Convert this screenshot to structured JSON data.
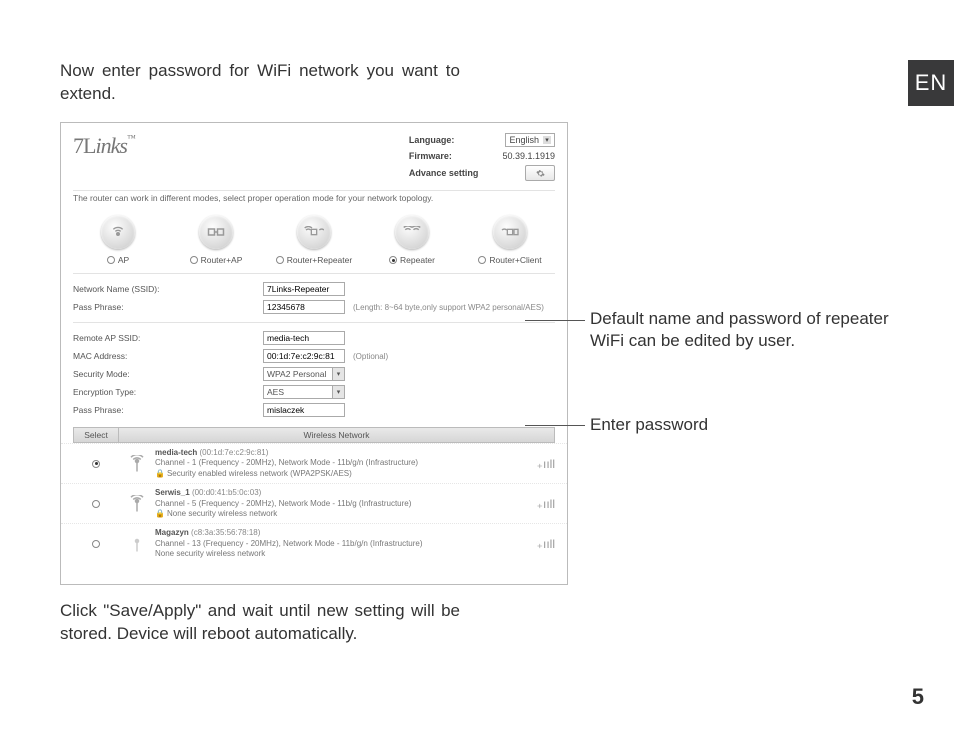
{
  "page": {
    "language_tab": "EN",
    "intro": "Now enter password for WiFi network you want to extend.",
    "outro": "Click \"Save/Apply\" and wait until new setting will be stored. Device will reboot automatically.",
    "page_number": "5"
  },
  "callouts": {
    "c1": "Default name and password of repeater WiFi can be edited by user.",
    "c2": "Enter password"
  },
  "ui": {
    "logo": "7Links",
    "header": {
      "language_label": "Language:",
      "language_value": "English",
      "firmware_label": "Firmware:",
      "firmware_value": "50.39.1.1919",
      "advance_label": "Advance setting"
    },
    "modes_desc": "The router can work in different modes, select proper operation mode for your network topology.",
    "modes": [
      {
        "label": "AP",
        "checked": false
      },
      {
        "label": "Router+AP",
        "checked": false
      },
      {
        "label": "Router+Repeater",
        "checked": false
      },
      {
        "label": "Repeater",
        "checked": true
      },
      {
        "label": "Router+Client",
        "checked": false
      }
    ],
    "section1": {
      "ssid_label": "Network Name (SSID):",
      "ssid_value": "7Links-Repeater",
      "pass_label": "Pass Phrase:",
      "pass_value": "12345678",
      "pass_hint": "(Length: 8~64 byte,only support WPA2 personal/AES)"
    },
    "section2": {
      "remote_ssid_label": "Remote AP SSID:",
      "remote_ssid_value": "media-tech",
      "mac_label": "MAC Address:",
      "mac_value": "00:1d:7e:c2:9c:81",
      "mac_hint": "(Optional)",
      "sec_label": "Security Mode:",
      "sec_value": "WPA2 Personal",
      "enc_label": "Encryption Type:",
      "enc_value": "AES",
      "pass_label": "Pass Phrase:",
      "pass_value": "mislaczek"
    },
    "wireless": {
      "select_header": "Select",
      "list_header": "Wireless Network",
      "rows": [
        {
          "checked": true,
          "secured": true,
          "name": "media-tech",
          "mac": "(00:1d:7e:c2:9c:81)",
          "line1": "Channel - 1 (Frequency - 20MHz), Network Mode - 11b/g/n (Infrastructure)",
          "line2": "Security enabled wireless network (WPA2PSK/AES)"
        },
        {
          "checked": false,
          "secured": true,
          "name": "Serwis_1",
          "mac": "(00:d0:41:b5:0c:03)",
          "line1": "Channel - 5 (Frequency - 20MHz), Network Mode - 11b/g (Infrastructure)",
          "line2": "None security wireless network"
        },
        {
          "checked": false,
          "secured": false,
          "name": "Magazyn",
          "mac": "(c8:3a:35:56:78:18)",
          "line1": "Channel - 13 (Frequency - 20MHz), Network Mode - 11b/g/n (Infrastructure)",
          "line2": "None security wireless network"
        }
      ]
    }
  }
}
